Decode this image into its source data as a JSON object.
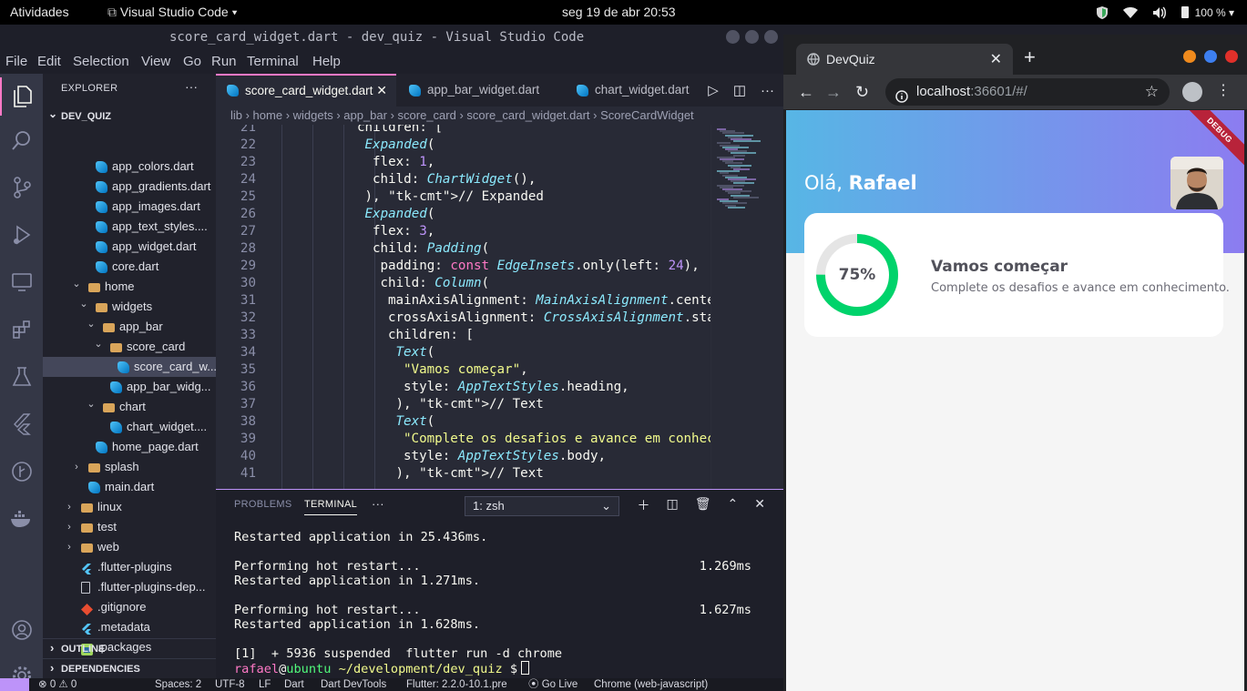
{
  "topbar": {
    "activities": "Atividades",
    "app_name": "Visual Studio Code",
    "datetime": "seg 19 de abr  20:53",
    "battery": "100 %"
  },
  "vscode": {
    "window_title": "score_card_widget.dart - dev_quiz - Visual Studio Code",
    "menu": [
      "File",
      "Edit",
      "Selection",
      "View",
      "Go",
      "Run",
      "Terminal",
      "Help"
    ],
    "explorer": {
      "header": "EXPLORER",
      "more": "···",
      "root": "DEV_QUIZ",
      "tree": [
        {
          "label": "app_colors.dart",
          "icon": "dart"
        },
        {
          "label": "app_gradients.dart",
          "icon": "dart"
        },
        {
          "label": "app_images.dart",
          "icon": "dart"
        },
        {
          "label": "app_text_styles....",
          "icon": "dart"
        },
        {
          "label": "app_widget.dart",
          "icon": "dart"
        },
        {
          "label": "core.dart",
          "icon": "dart"
        },
        {
          "label": "home",
          "icon": "folder"
        },
        {
          "label": "widgets",
          "icon": "folder"
        },
        {
          "label": "app_bar",
          "icon": "folder"
        },
        {
          "label": "score_card",
          "icon": "folder"
        },
        {
          "label": "score_card_w...",
          "icon": "dart"
        },
        {
          "label": "app_bar_widg...",
          "icon": "dart"
        },
        {
          "label": "chart",
          "icon": "folder"
        },
        {
          "label": "chart_widget....",
          "icon": "dart"
        },
        {
          "label": "home_page.dart",
          "icon": "dart"
        },
        {
          "label": "splash",
          "icon": "folder"
        },
        {
          "label": "main.dart",
          "icon": "dart"
        },
        {
          "label": "linux",
          "icon": "folder"
        },
        {
          "label": "test",
          "icon": "folder"
        },
        {
          "label": "web",
          "icon": "folder"
        },
        {
          "label": ".flutter-plugins",
          "icon": "flutter"
        },
        {
          "label": ".flutter-plugins-dep...",
          "icon": "file"
        },
        {
          "label": ".gitignore",
          "icon": "git"
        },
        {
          "label": ".metadata",
          "icon": "flutter"
        },
        {
          "label": ".packages",
          "icon": "packages"
        }
      ],
      "outline": "OUTLINE",
      "dependencies": "DEPENDENCIES"
    },
    "tabs": [
      {
        "label": "score_card_widget.dart",
        "close": "✕"
      },
      {
        "label": "app_bar_widget.dart"
      },
      {
        "label": "chart_widget.dart"
      }
    ],
    "breadcrumb": "lib › home › widgets › app_bar › score_card › score_card_widget.dart › ScoreCardWidget",
    "code": {
      "line_numbers": [
        "21",
        "22",
        "23",
        "24",
        "25",
        "26",
        "27",
        "28",
        "29",
        "30",
        "31",
        "32",
        "33",
        "34",
        "35",
        "36",
        "37",
        "38",
        "39",
        "40",
        "41"
      ],
      "lines": [
        "children: [",
        "Expanded(",
        "flex: 1,",
        "child: ChartWidget(),",
        "), // Expanded",
        "Expanded(",
        "flex: 3,",
        "child: Padding(",
        "padding: const EdgeInsets.only(left: 24),",
        "child: Column(",
        "mainAxisAlignment: MainAxisAlignment.center,",
        "crossAxisAlignment: CrossAxisAlignment.start,",
        "children: [",
        "Text(",
        "\"Vamos começar\",",
        "style: AppTextStyles.heading,",
        "), // Text",
        "Text(",
        "\"Complete os desafios e avance em conhecimento.\",",
        "style: AppTextStyles.body,",
        "), // Text"
      ]
    },
    "panel": {
      "tabs": [
        "PROBLEMS",
        "TERMINAL"
      ],
      "more": "···",
      "terminal_select": "1: zsh",
      "terminal_lines": [
        {
          "text": "Restarted application in 25.436ms.",
          "right": ""
        },
        {
          "text": "",
          "right": ""
        },
        {
          "text": "Performing hot restart...",
          "right": "1.269ms"
        },
        {
          "text": "Restarted application in 1.271ms.",
          "right": ""
        },
        {
          "text": "",
          "right": ""
        },
        {
          "text": "Performing hot restart...",
          "right": "1.627ms"
        },
        {
          "text": "Restarted application in 1.628ms.",
          "right": ""
        },
        {
          "text": "",
          "right": ""
        },
        {
          "text": "[1]  + 5936 suspended  flutter run -d chrome",
          "right": ""
        }
      ],
      "prompt": {
        "user": "rafael",
        "at": "@",
        "host": "ubuntu",
        "path": "~/development/dev_quiz",
        "symbol": "$"
      }
    },
    "status": {
      "problems": "⊗ 0 ⚠ 0",
      "spaces": "Spaces: 2",
      "encoding": "UTF-8",
      "eol": "LF",
      "language": "Dart",
      "devtools": "Dart DevTools",
      "flutter": "Flutter: 2.2.0-10.1.pre",
      "golive": "⦿ Go Live",
      "device": "Chrome (web-javascript)"
    }
  },
  "chrome": {
    "tab_title": "DevQuiz",
    "tab_close": "✕",
    "new_tab": "+",
    "url_host": "localhost",
    "url_rest": ":36601/#/",
    "app": {
      "greeting": "Olá, ",
      "user_name": "Rafael",
      "debug_label": "DEBUG",
      "score_percent_text": "75%",
      "score_fraction": 0.75,
      "card_title": "Vamos começar",
      "card_subtitle": "Complete os desafios e avance em conhecimento."
    }
  },
  "colors": {
    "accent_pink": "#ff79c6",
    "accent_purple": "#bd93f9",
    "ring_green": "#00d36b",
    "ring_track": "#e5e5e5",
    "header_left": "#57b6e5",
    "header_right": "#8c7cf0"
  }
}
